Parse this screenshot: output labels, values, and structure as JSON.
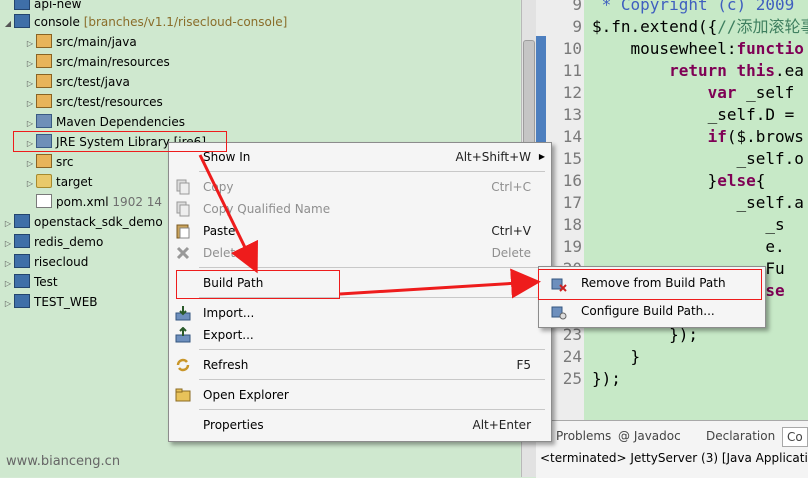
{
  "tree": [
    {
      "label": "api-new"
    },
    {
      "label": "console",
      "suffix": "[branches/v1.1/risecloud-console]"
    },
    {
      "label": "src/main/java"
    },
    {
      "label": "src/main/resources"
    },
    {
      "label": "src/test/java"
    },
    {
      "label": "src/test/resources"
    },
    {
      "label": "Maven Dependencies"
    },
    {
      "label": "JRE System Library [jre6]"
    },
    {
      "label": "src"
    },
    {
      "label": "target"
    },
    {
      "label": "pom.xml",
      "meta": "1902  14"
    },
    {
      "label": "openstack_sdk_demo"
    },
    {
      "label": "redis_demo"
    },
    {
      "label": "risecloud"
    },
    {
      "label": "Test"
    },
    {
      "label": "TEST_WEB"
    }
  ],
  "context_menu": {
    "items": [
      {
        "label": "Show In",
        "accel": "Alt+Shift+W"
      },
      {
        "label": "Copy",
        "accel": "Ctrl+C"
      },
      {
        "label": "Copy Qualified Name",
        "accel": ""
      },
      {
        "label": "Paste",
        "accel": "Ctrl+V"
      },
      {
        "label": "Delete",
        "accel": "Delete"
      },
      {
        "label": "Build Path",
        "accel": ""
      },
      {
        "label": "Import...",
        "accel": ""
      },
      {
        "label": "Export...",
        "accel": ""
      },
      {
        "label": "Refresh",
        "accel": "F5"
      },
      {
        "label": "Open Explorer",
        "accel": ""
      },
      {
        "label": "Properties",
        "accel": "Alt+Enter"
      }
    ]
  },
  "submenu": {
    "items": [
      {
        "label": "Remove from Build Path"
      },
      {
        "label": "Configure Build Path..."
      }
    ]
  },
  "editor": {
    "lines": [
      {
        "n": "9",
        "parts": [
          {
            "t": " * Copyright (c) 2009",
            "c": "doc"
          }
        ]
      },
      {
        "n": "9",
        "parts": [
          {
            "t": "$.fn.extend({",
            "c": ""
          },
          {
            "t": "//添加滚轮事",
            "c": "cm"
          }
        ]
      },
      {
        "n": "10",
        "parts": [
          {
            "t": "    mousewheel:",
            "c": ""
          },
          {
            "t": "functio",
            "c": "kw"
          }
        ]
      },
      {
        "n": "11",
        "parts": [
          {
            "t": "        ",
            "c": ""
          },
          {
            "t": "return",
            "c": "kw"
          },
          {
            "t": " ",
            "c": ""
          },
          {
            "t": "this",
            "c": "kw"
          },
          {
            "t": ".ea",
            "c": ""
          }
        ]
      },
      {
        "n": "12",
        "parts": [
          {
            "t": "            ",
            "c": ""
          },
          {
            "t": "var",
            "c": "kw"
          },
          {
            "t": " _self",
            "c": ""
          }
        ]
      },
      {
        "n": "13",
        "parts": [
          {
            "t": "            _self.D =",
            "c": ""
          }
        ]
      },
      {
        "n": "14",
        "parts": [
          {
            "t": "            ",
            "c": ""
          },
          {
            "t": "if",
            "c": "kw"
          },
          {
            "t": "($.brows",
            "c": ""
          }
        ]
      },
      {
        "n": "15",
        "parts": [
          {
            "t": "               _self.o",
            "c": ""
          }
        ]
      },
      {
        "n": "16",
        "parts": [
          {
            "t": "            }",
            "c": ""
          },
          {
            "t": "else",
            "c": "kw"
          },
          {
            "t": "{",
            "c": ""
          }
        ]
      },
      {
        "n": "17",
        "parts": [
          {
            "t": "               _self.a",
            "c": ""
          }
        ]
      },
      {
        "n": "18",
        "parts": [
          {
            "t": "                  _s",
            "c": ""
          }
        ]
      },
      {
        "n": "19",
        "parts": [
          {
            "t": "                  e.",
            "c": ""
          }
        ]
      },
      {
        "n": "20",
        "parts": [
          {
            "t": "                  Fu",
            "c": ""
          }
        ]
      },
      {
        "n": "21",
        "parts": [
          {
            "t": "               ",
            "c": ""
          },
          {
            "t": "false",
            "c": "kw"
          }
        ]
      },
      {
        "n": "22",
        "parts": [
          {
            "t": "            }",
            "c": ""
          }
        ]
      },
      {
        "n": "23",
        "parts": [
          {
            "t": "        });",
            "c": ""
          }
        ]
      },
      {
        "n": "24",
        "parts": [
          {
            "t": "    }",
            "c": ""
          }
        ]
      },
      {
        "n": "25",
        "parts": [
          {
            "t": "});",
            "c": ""
          }
        ]
      }
    ]
  },
  "bottom_tabs": [
    {
      "label": "Problems"
    },
    {
      "label": "@ Javadoc"
    },
    {
      "label": "Declaration"
    },
    {
      "label": "Co"
    }
  ],
  "console_text": "<terminated> JettyServer (3) [Java Application",
  "watermark": "www.bianceng.cn",
  "colors": {
    "highlight": "#ee1c1c",
    "menu_bg": "#f5f5f5",
    "editor_bg": "#c7e9c7"
  }
}
